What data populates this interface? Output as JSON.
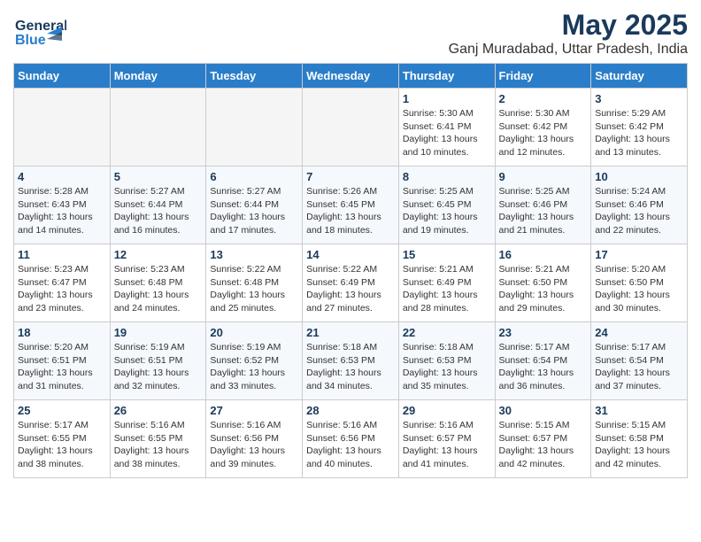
{
  "header": {
    "logo_line1": "General",
    "logo_line2": "Blue",
    "main_title": "May 2025",
    "subtitle": "Ganj Muradabad, Uttar Pradesh, India"
  },
  "weekdays": [
    "Sunday",
    "Monday",
    "Tuesday",
    "Wednesday",
    "Thursday",
    "Friday",
    "Saturday"
  ],
  "weeks": [
    [
      {
        "day": "",
        "info": ""
      },
      {
        "day": "",
        "info": ""
      },
      {
        "day": "",
        "info": ""
      },
      {
        "day": "",
        "info": ""
      },
      {
        "day": "1",
        "info": "Sunrise: 5:30 AM\nSunset: 6:41 PM\nDaylight: 13 hours\nand 10 minutes."
      },
      {
        "day": "2",
        "info": "Sunrise: 5:30 AM\nSunset: 6:42 PM\nDaylight: 13 hours\nand 12 minutes."
      },
      {
        "day": "3",
        "info": "Sunrise: 5:29 AM\nSunset: 6:42 PM\nDaylight: 13 hours\nand 13 minutes."
      }
    ],
    [
      {
        "day": "4",
        "info": "Sunrise: 5:28 AM\nSunset: 6:43 PM\nDaylight: 13 hours\nand 14 minutes."
      },
      {
        "day": "5",
        "info": "Sunrise: 5:27 AM\nSunset: 6:44 PM\nDaylight: 13 hours\nand 16 minutes."
      },
      {
        "day": "6",
        "info": "Sunrise: 5:27 AM\nSunset: 6:44 PM\nDaylight: 13 hours\nand 17 minutes."
      },
      {
        "day": "7",
        "info": "Sunrise: 5:26 AM\nSunset: 6:45 PM\nDaylight: 13 hours\nand 18 minutes."
      },
      {
        "day": "8",
        "info": "Sunrise: 5:25 AM\nSunset: 6:45 PM\nDaylight: 13 hours\nand 19 minutes."
      },
      {
        "day": "9",
        "info": "Sunrise: 5:25 AM\nSunset: 6:46 PM\nDaylight: 13 hours\nand 21 minutes."
      },
      {
        "day": "10",
        "info": "Sunrise: 5:24 AM\nSunset: 6:46 PM\nDaylight: 13 hours\nand 22 minutes."
      }
    ],
    [
      {
        "day": "11",
        "info": "Sunrise: 5:23 AM\nSunset: 6:47 PM\nDaylight: 13 hours\nand 23 minutes."
      },
      {
        "day": "12",
        "info": "Sunrise: 5:23 AM\nSunset: 6:48 PM\nDaylight: 13 hours\nand 24 minutes."
      },
      {
        "day": "13",
        "info": "Sunrise: 5:22 AM\nSunset: 6:48 PM\nDaylight: 13 hours\nand 25 minutes."
      },
      {
        "day": "14",
        "info": "Sunrise: 5:22 AM\nSunset: 6:49 PM\nDaylight: 13 hours\nand 27 minutes."
      },
      {
        "day": "15",
        "info": "Sunrise: 5:21 AM\nSunset: 6:49 PM\nDaylight: 13 hours\nand 28 minutes."
      },
      {
        "day": "16",
        "info": "Sunrise: 5:21 AM\nSunset: 6:50 PM\nDaylight: 13 hours\nand 29 minutes."
      },
      {
        "day": "17",
        "info": "Sunrise: 5:20 AM\nSunset: 6:50 PM\nDaylight: 13 hours\nand 30 minutes."
      }
    ],
    [
      {
        "day": "18",
        "info": "Sunrise: 5:20 AM\nSunset: 6:51 PM\nDaylight: 13 hours\nand 31 minutes."
      },
      {
        "day": "19",
        "info": "Sunrise: 5:19 AM\nSunset: 6:51 PM\nDaylight: 13 hours\nand 32 minutes."
      },
      {
        "day": "20",
        "info": "Sunrise: 5:19 AM\nSunset: 6:52 PM\nDaylight: 13 hours\nand 33 minutes."
      },
      {
        "day": "21",
        "info": "Sunrise: 5:18 AM\nSunset: 6:53 PM\nDaylight: 13 hours\nand 34 minutes."
      },
      {
        "day": "22",
        "info": "Sunrise: 5:18 AM\nSunset: 6:53 PM\nDaylight: 13 hours\nand 35 minutes."
      },
      {
        "day": "23",
        "info": "Sunrise: 5:17 AM\nSunset: 6:54 PM\nDaylight: 13 hours\nand 36 minutes."
      },
      {
        "day": "24",
        "info": "Sunrise: 5:17 AM\nSunset: 6:54 PM\nDaylight: 13 hours\nand 37 minutes."
      }
    ],
    [
      {
        "day": "25",
        "info": "Sunrise: 5:17 AM\nSunset: 6:55 PM\nDaylight: 13 hours\nand 38 minutes."
      },
      {
        "day": "26",
        "info": "Sunrise: 5:16 AM\nSunset: 6:55 PM\nDaylight: 13 hours\nand 38 minutes."
      },
      {
        "day": "27",
        "info": "Sunrise: 5:16 AM\nSunset: 6:56 PM\nDaylight: 13 hours\nand 39 minutes."
      },
      {
        "day": "28",
        "info": "Sunrise: 5:16 AM\nSunset: 6:56 PM\nDaylight: 13 hours\nand 40 minutes."
      },
      {
        "day": "29",
        "info": "Sunrise: 5:16 AM\nSunset: 6:57 PM\nDaylight: 13 hours\nand 41 minutes."
      },
      {
        "day": "30",
        "info": "Sunrise: 5:15 AM\nSunset: 6:57 PM\nDaylight: 13 hours\nand 42 minutes."
      },
      {
        "day": "31",
        "info": "Sunrise: 5:15 AM\nSunset: 6:58 PM\nDaylight: 13 hours\nand 42 minutes."
      }
    ]
  ]
}
